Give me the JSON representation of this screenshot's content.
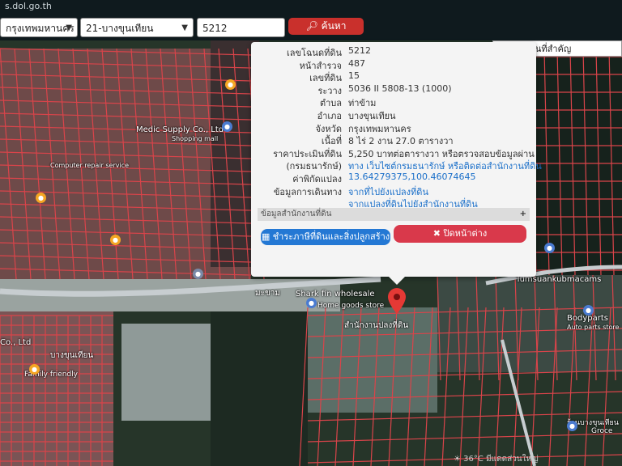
{
  "browser": {
    "url": "s.dol.go.th"
  },
  "toolbar": {
    "province": "กรุงเทพมหานคร",
    "district": "21-บางขุนเทียน",
    "parcel_input": "5212",
    "search_label": "ค้นหา"
  },
  "place_search": {
    "placeholder": "ค้นหาสถานที่สำคัญ"
  },
  "popup": {
    "rows": [
      {
        "label": "เลขโฉนดที่ดิน",
        "value": "5212"
      },
      {
        "label": "หน้าสำรวจ",
        "value": "487"
      },
      {
        "label": "เลขที่ดิน",
        "value": "15"
      },
      {
        "label": "ระวาง",
        "value": "5036 II 5808-13 (1000)"
      },
      {
        "label": "ตำบล",
        "value": "ท่าข้าม"
      },
      {
        "label": "อำเภอ",
        "value": "บางขุนเทียน"
      },
      {
        "label": "จังหวัด",
        "value": "กรุงเทพมหานคร"
      },
      {
        "label": "เนื้อที่",
        "value": "8 ไร่ 2 งาน 27.0 ตารางวา"
      },
      {
        "label": "ราคาประเมินที่ดิน",
        "value": "5,250 บาทต่อตารางวา หรือตรวจสอบข้อมูลผ่าน"
      },
      {
        "label": "(กรมธนารักษ์)",
        "value": "ทาง เว็บไซต์กรมธนารักษ์ หรือติดต่อสำนักงานที่ดิน"
      },
      {
        "label": "ค่าพิกัดแปลง",
        "value": "13.64279375,100.46074645"
      },
      {
        "label": "ข้อมูลการเดินทาง",
        "value": "จากที่ไปยังแปลงที่ดิน"
      },
      {
        "label": "",
        "value": "จากแปลงที่ดินไปยังสำนักงานที่ดิน"
      }
    ],
    "office_section": "ข้อมูลสำนักงานที่ดิน",
    "pay_button": "ชำระภาษีที่ดินและสิ่งปลูกสร้าง",
    "close_button": "ปิดหน้าต่าง"
  },
  "map_labels": {
    "medic": "Medic Supply Co., Ltd",
    "shopping": "Shopping mall",
    "computer": "Computer repair service",
    "sharkfin": "Shark fin wholesale",
    "homegoods": "Home goods store",
    "tumsuan": "Tumsuankubmacams",
    "bodyparts": "Bodyparts",
    "autoparts": "Auto parts store",
    "family": "Family friendly",
    "coltd": "Co., Ltd",
    "grocery": "Groce",
    "thai1": "มะขาม",
    "thai2": "สำนักงานปลงที่ดิน",
    "thai3": "บางขุนเทียน",
    "thai4": "ร้านบางขุนเทียน"
  },
  "taskbar": {
    "weather": "36°C",
    "extra": "มีแดดส่วนใหญ่"
  },
  "colors": {
    "parcel_line": "#d9444a",
    "map_bg": "#2a3a30",
    "pin": "#e53935"
  }
}
